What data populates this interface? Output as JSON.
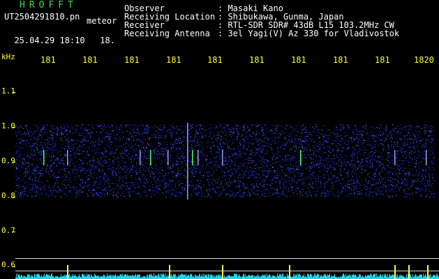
{
  "app": {
    "title": "HROFFT"
  },
  "file": {
    "name": "UT2504291810.pn",
    "suffix": "meteor",
    "timestamp": "25.04.29 18:10",
    "minute": "18."
  },
  "info": [
    {
      "label": "Observer",
      "value": ": Masaki Kano"
    },
    {
      "label": "Receiving Location",
      "value": ": Shibukawa, Gunma, Japan"
    },
    {
      "label": "Receiver",
      "value": ": RTL-SDR SDR# 43dB L15 103.2MHz CW"
    },
    {
      "label": "Receiving Antenna",
      "value": ": 3el Yagi(V) Az 330 for Vladivostok"
    }
  ],
  "axis": {
    "unit": "kHz",
    "x_ticks": [
      "181",
      "181",
      "181",
      "181",
      "181",
      "181",
      "181",
      "181",
      "181",
      "1820"
    ],
    "y_ticks": [
      "1.1",
      "1.0",
      "0.9",
      "0.8",
      "0.7",
      "0.6"
    ]
  },
  "colors": {
    "title_green": "#3fd94a",
    "tick_yellow": "#ffff33",
    "noise_blue": "#1b2dff",
    "baseline_cyan": "#22d6e6"
  }
}
